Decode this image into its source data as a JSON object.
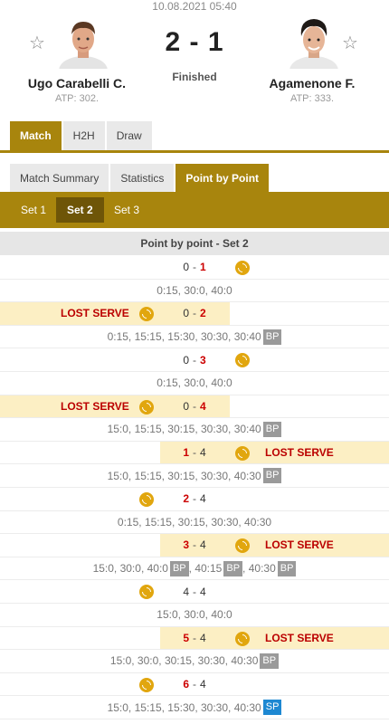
{
  "header": {
    "datetime": "10.08.2021 05:40",
    "home": {
      "name": "Ugo Carabelli C.",
      "rank": "ATP: 302."
    },
    "away": {
      "name": "Agamenone F.",
      "rank": "ATP: 333."
    },
    "score": "2 - 1",
    "status": "Finished"
  },
  "main_tabs": [
    "Match",
    "H2H",
    "Draw"
  ],
  "sub_tabs": [
    "Match Summary",
    "Statistics",
    "Point by Point"
  ],
  "set_tabs": [
    "Set 1",
    "Set 2",
    "Set 3"
  ],
  "section_title": "Point by point - Set 2",
  "lost_serve_label": "LOST SERVE",
  "rows": [
    {
      "type": "game",
      "home": "0",
      "away": "1",
      "winner": "away",
      "server": "away",
      "lost": ""
    },
    {
      "type": "points",
      "segments": [
        {
          "text": "0:15, 30:0, 40:0",
          "badge": ""
        }
      ]
    },
    {
      "type": "game",
      "home": "0",
      "away": "2",
      "winner": "away",
      "server": "home",
      "lost": "home"
    },
    {
      "type": "points",
      "segments": [
        {
          "text": "0:15, 15:15, 15:30, 30:30, 30:40",
          "badge": "BP"
        }
      ]
    },
    {
      "type": "game",
      "home": "0",
      "away": "3",
      "winner": "away",
      "server": "away",
      "lost": ""
    },
    {
      "type": "points",
      "segments": [
        {
          "text": "0:15, 30:0, 40:0",
          "badge": ""
        }
      ]
    },
    {
      "type": "game",
      "home": "0",
      "away": "4",
      "winner": "away",
      "server": "home",
      "lost": "home"
    },
    {
      "type": "points",
      "segments": [
        {
          "text": "15:0, 15:15, 30:15, 30:30, 30:40",
          "badge": "BP"
        }
      ]
    },
    {
      "type": "game",
      "home": "1",
      "away": "4",
      "winner": "home",
      "server": "away",
      "lost": "away"
    },
    {
      "type": "points",
      "segments": [
        {
          "text": "15:0, 15:15, 30:15, 30:30, 40:30",
          "badge": "BP"
        }
      ]
    },
    {
      "type": "game",
      "home": "2",
      "away": "4",
      "winner": "home",
      "server": "home",
      "lost": ""
    },
    {
      "type": "points",
      "segments": [
        {
          "text": "0:15, 15:15, 30:15, 30:30, 40:30",
          "badge": ""
        }
      ]
    },
    {
      "type": "game",
      "home": "3",
      "away": "4",
      "winner": "home",
      "server": "away",
      "lost": "away"
    },
    {
      "type": "points",
      "segments": [
        {
          "text": "15:0, 30:0, 40:0",
          "badge": "BP"
        },
        {
          "text": ", 40:15",
          "badge": "BP"
        },
        {
          "text": ", 40:30",
          "badge": "BP"
        }
      ]
    },
    {
      "type": "game",
      "home": "4",
      "away": "4",
      "winner": "",
      "server": "home",
      "lost": ""
    },
    {
      "type": "points",
      "segments": [
        {
          "text": "15:0, 30:0, 40:0",
          "badge": ""
        }
      ]
    },
    {
      "type": "game",
      "home": "5",
      "away": "4",
      "winner": "home",
      "server": "away",
      "lost": "away"
    },
    {
      "type": "points",
      "segments": [
        {
          "text": "15:0, 30:0, 30:15, 30:30, 40:30",
          "badge": "BP"
        }
      ]
    },
    {
      "type": "game",
      "home": "6",
      "away": "4",
      "winner": "home",
      "server": "home",
      "lost": ""
    },
    {
      "type": "points",
      "segments": [
        {
          "text": "15:0, 15:15, 15:30, 30:30, 40:30",
          "badge": "SP"
        }
      ]
    }
  ],
  "icons": {
    "favorite": "star-outline-icon",
    "serve": "tennis-ball-icon"
  },
  "colors": {
    "accent": "#a8850d",
    "accent_dark": "#6e5508",
    "highlight": "#fcefc4",
    "lost_text": "#b00000",
    "ball": "#e1a60e",
    "sp_badge": "#1e88d2"
  }
}
